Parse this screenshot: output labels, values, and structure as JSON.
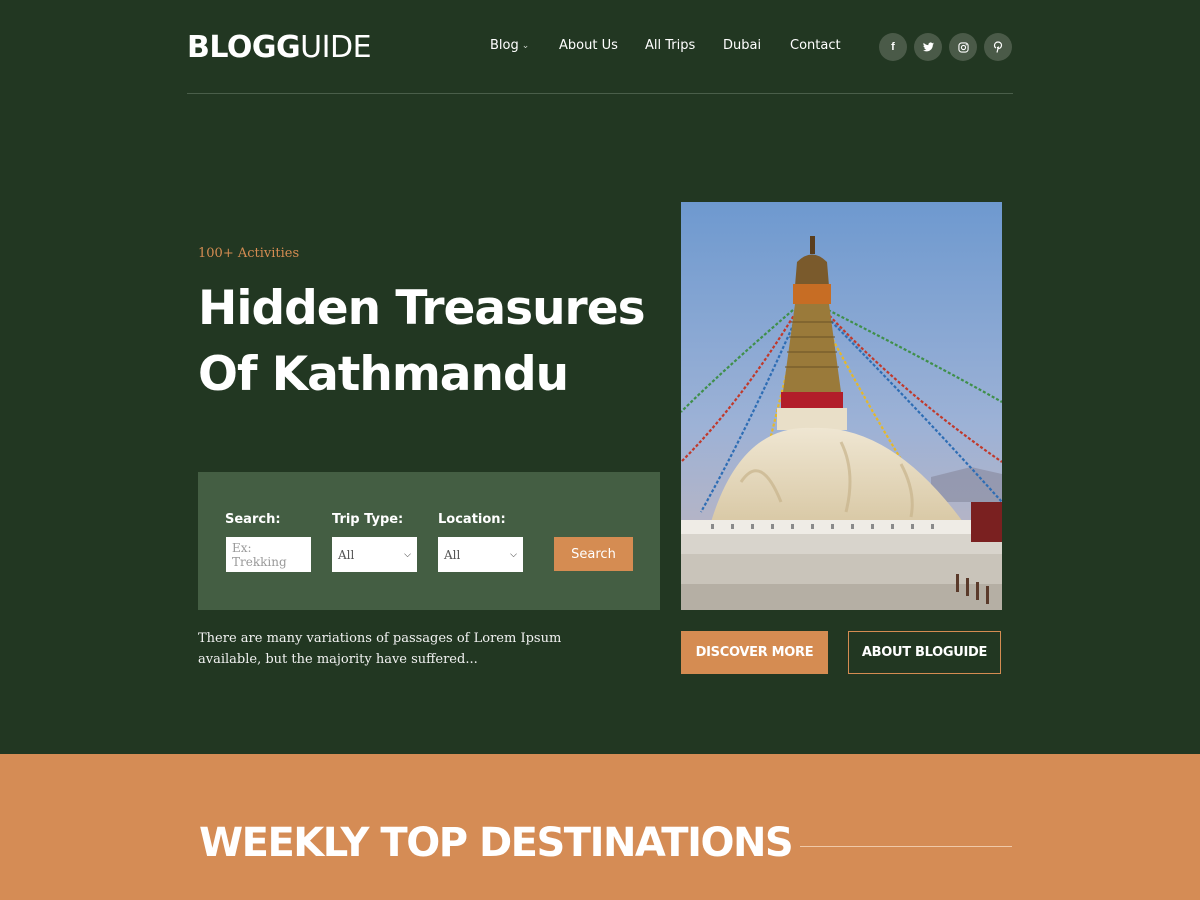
{
  "header": {
    "logo_bold": "BLOG",
    "logo_light": "UIDE",
    "nav": [
      {
        "label": "Blog",
        "has_dropdown": true
      },
      {
        "label": "About Us"
      },
      {
        "label": "All Trips"
      },
      {
        "label": "Dubai"
      },
      {
        "label": "Contact"
      }
    ],
    "social": [
      {
        "icon": "facebook-icon",
        "glyph": "f"
      },
      {
        "icon": "twitter-icon",
        "glyph": "t"
      },
      {
        "icon": "instagram-icon",
        "glyph": "◎"
      },
      {
        "icon": "pinterest-icon",
        "glyph": "p"
      }
    ]
  },
  "hero": {
    "kicker": "100+ Activities",
    "title_line1": "Hidden Treasures",
    "title_line2": "Of Kathmandu",
    "description": "There are many variations of passages of Lorem Ipsum available, but the majority have suffered..."
  },
  "search_form": {
    "search_label": "Search:",
    "search_placeholder": "Ex: Trekking",
    "trip_type_label": "Trip Type:",
    "trip_type_value": "All",
    "location_label": "Location:",
    "location_value": "All",
    "button": "Search"
  },
  "buttons": {
    "discover": "DISCOVER MORE",
    "about": "ABOUT BLOGUIDE"
  },
  "section": {
    "title": "WEEKLY TOP DESTINATIONS"
  },
  "colors": {
    "background": "#223722",
    "accent": "#d58c52",
    "search_panel": "#445e43"
  }
}
